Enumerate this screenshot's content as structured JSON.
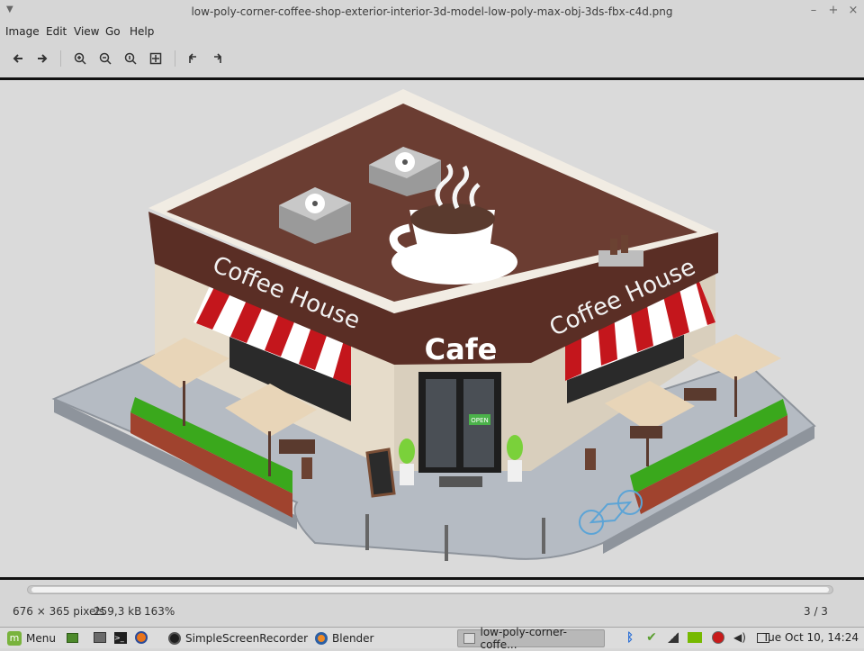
{
  "window": {
    "title": "low-poly-corner-coffee-shop-exterior-interior-3d-model-low-poly-max-obj-3ds-fbx-c4d.png"
  },
  "menu": [
    {
      "label": "Image"
    },
    {
      "label": "Edit"
    },
    {
      "label": "View"
    },
    {
      "label": "Go"
    },
    {
      "label": "Help"
    }
  ],
  "image_text": {
    "sign_left": "Coffee House",
    "sign_center": "Cafe",
    "sign_right": "Coffee House",
    "door_sign": "OPEN"
  },
  "status": {
    "dimensions": "676 × 365 pixels",
    "file_size": "259,3 kB",
    "zoom": "163%",
    "position": "3 / 3"
  },
  "taskbar": {
    "menu_label": "Menu",
    "tasks": [
      {
        "label": "SimpleScreenRecorder",
        "icon": "screen-recorder-icon"
      },
      {
        "label": "Blender",
        "icon": "blender-icon"
      },
      {
        "label": "low-poly-corner-coffe...",
        "icon": "image-viewer-icon"
      }
    ],
    "clock": "Tue Oct 10, 14:24"
  },
  "colors": {
    "roof": "#6b3d32",
    "wall_dark": "#5a2e25",
    "awning_red": "#c4161c",
    "hedge_green": "#3aa81c",
    "floor": "#b8bdc4"
  }
}
